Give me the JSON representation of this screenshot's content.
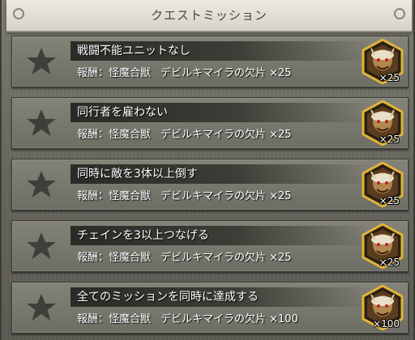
{
  "header": {
    "title": "クエストミッション"
  },
  "missions": [
    {
      "name": "戦闘不能ユニットなし",
      "reward_prefix": "報酬：怪魔合獣",
      "reward_item": "デビルキマイラの欠片 ×25",
      "count": "×25",
      "completed": false
    },
    {
      "name": "同行者を雇わない",
      "reward_prefix": "報酬：怪魔合獣",
      "reward_item": "デビルキマイラの欠片 ×25",
      "count": "×25",
      "completed": false
    },
    {
      "name": "同時に敵を3体以上倒す",
      "reward_prefix": "報酬：怪魔合獣",
      "reward_item": "デビルキマイラの欠片 ×25",
      "count": "×25",
      "completed": false
    },
    {
      "name": "チェインを3以上つなげる",
      "reward_prefix": "報酬：怪魔合獣",
      "reward_item": "デビルキマイラの欠片 ×25",
      "count": "×25",
      "completed": false
    },
    {
      "name": "全てのミッションを同時に達成する",
      "reward_prefix": "報酬：怪魔合獣",
      "reward_item": "デビルキマイラの欠片 ×100",
      "count": "×100",
      "completed": false
    }
  ],
  "colors": {
    "star_incomplete": "#3f3e39",
    "item_frame": "#e0b43a",
    "panel_bg": "#6b6b63",
    "header_bg": "#e4e2d8"
  },
  "icons": {
    "mission_status": "star-icon",
    "reward_item": "chimera-shard-icon"
  }
}
